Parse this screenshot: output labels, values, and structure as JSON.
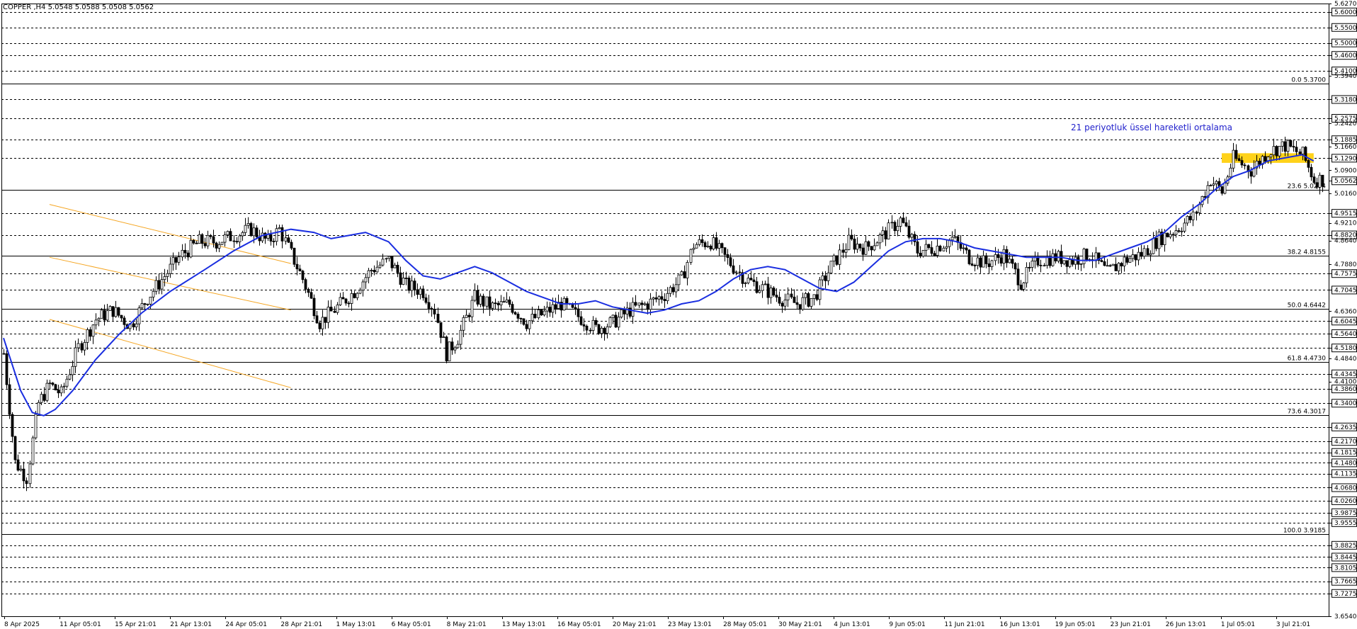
{
  "header": {
    "symbol_ohlc": "COPPER ,H4  5.0548 5.0588 5.0508 5.0562"
  },
  "colors": {
    "background": "#ffffff",
    "candle": "#000000",
    "ema": "#1a2ee0",
    "channel": "#f5a623",
    "zone": "#ffd21a",
    "annotation": "#2222cc"
  },
  "annotation": {
    "ema_label": "21 periyotluk üssel hareketli ortalama"
  },
  "chart_data": {
    "type": "candlestick",
    "symbol": "COPPER",
    "timeframe": "H4",
    "ylim": [
      3.654,
      5.627
    ],
    "current_price": 5.0562,
    "x_tick_labels": [
      "8 Apr 2025",
      "11 Apr 05:01",
      "15 Apr 21:01",
      "21 Apr 13:01",
      "24 Apr 05:01",
      "28 Apr 21:01",
      "1 May 13:01",
      "6 May 05:01",
      "8 May 21:01",
      "13 May 13:01",
      "16 May 05:01",
      "20 May 21:01",
      "23 May 13:01",
      "28 May 05:01",
      "30 May 21:01",
      "4 Jun 13:01",
      "9 Jun 05:01",
      "11 Jun 21:01",
      "16 Jun 13:01",
      "19 Jun 05:01",
      "23 Jun 21:01",
      "26 Jun 13:01",
      "1 Jul 05:01",
      "3 Jul 21:01"
    ],
    "price_axis_labels": [
      "5.6270",
      "5.6000",
      "5.5500",
      "5.5000",
      "5.4600",
      "5.4100",
      "5.3940",
      "5.3180",
      "5.2575",
      "5.2420",
      "5.1885",
      "5.1660",
      "5.1290",
      "5.0900",
      "5.0562",
      "5.0160",
      "4.9515",
      "4.9210",
      "4.8820",
      "4.8640",
      "4.7880",
      "4.7575",
      "4.7045",
      "4.6360",
      "4.6045",
      "4.5640",
      "4.5180",
      "4.4840",
      "4.4345",
      "4.4100",
      "4.3860",
      "4.3400",
      "4.2635",
      "4.2170",
      "4.1815",
      "4.1480",
      "4.1135",
      "4.0680",
      "4.0260",
      "3.9875",
      "3.9555",
      "3.8825",
      "3.8445",
      "3.8105",
      "3.7665",
      "3.7275",
      "3.6540"
    ],
    "highlighted_price_labels": [
      "5.6000",
      "5.5500",
      "5.5000",
      "5.4600",
      "5.4100",
      "5.3180",
      "5.2575",
      "5.1885",
      "5.1290",
      "5.0562",
      "4.9515",
      "4.8820",
      "4.7575",
      "4.7045",
      "4.6045",
      "4.5640",
      "4.5180",
      "4.4345",
      "4.3860",
      "4.3400",
      "4.2635",
      "4.2170",
      "4.1815",
      "4.1480",
      "4.1135",
      "4.0680",
      "4.0260",
      "3.9875",
      "3.9555",
      "3.8825",
      "3.8445",
      "3.8105",
      "3.7665",
      "3.7275"
    ],
    "dashed_levels": [
      5.6,
      5.55,
      5.5,
      5.46,
      5.41,
      5.318,
      5.2575,
      5.1885,
      5.129,
      4.9515,
      4.882,
      4.7575,
      4.7045,
      4.6045,
      4.564,
      4.518,
      4.4345,
      4.386,
      4.34,
      4.2635,
      4.217,
      4.1815,
      4.148,
      4.1135,
      4.068,
      4.026,
      3.9875,
      3.9555,
      3.8825,
      3.8445,
      3.8105,
      3.7665,
      3.7275
    ],
    "fibonacci": [
      {
        "label": "0.0 5.3700",
        "price": 5.37
      },
      {
        "label": "23.6 5.0274",
        "price": 5.0274
      },
      {
        "label": "38.2 4.8155",
        "price": 4.8155
      },
      {
        "label": "50.0 4.6442",
        "price": 4.6442
      },
      {
        "label": "61.8 4.4730",
        "price": 4.473
      },
      {
        "label": "73.6 4.3017",
        "price": 4.3017
      },
      {
        "label": "100.0 3.9185",
        "price": 3.9185
      }
    ],
    "ema_period": 21,
    "ema_points": [
      [
        0,
        4.55
      ],
      [
        6,
        4.38
      ],
      [
        10,
        4.31
      ],
      [
        14,
        4.3
      ],
      [
        18,
        4.32
      ],
      [
        24,
        4.38
      ],
      [
        32,
        4.48
      ],
      [
        40,
        4.56
      ],
      [
        48,
        4.63
      ],
      [
        58,
        4.7
      ],
      [
        70,
        4.77
      ],
      [
        80,
        4.83
      ],
      [
        90,
        4.88
      ],
      [
        100,
        4.9
      ],
      [
        108,
        4.89
      ],
      [
        114,
        4.87
      ],
      [
        120,
        4.88
      ],
      [
        126,
        4.89
      ],
      [
        134,
        4.86
      ],
      [
        140,
        4.8
      ],
      [
        146,
        4.75
      ],
      [
        152,
        4.74
      ],
      [
        158,
        4.76
      ],
      [
        164,
        4.78
      ],
      [
        170,
        4.76
      ],
      [
        176,
        4.73
      ],
      [
        182,
        4.7
      ],
      [
        188,
        4.68
      ],
      [
        194,
        4.66
      ],
      [
        200,
        4.66
      ],
      [
        206,
        4.67
      ],
      [
        212,
        4.65
      ],
      [
        218,
        4.64
      ],
      [
        224,
        4.63
      ],
      [
        230,
        4.64
      ],
      [
        236,
        4.66
      ],
      [
        242,
        4.67
      ],
      [
        248,
        4.7
      ],
      [
        254,
        4.74
      ],
      [
        260,
        4.77
      ],
      [
        266,
        4.78
      ],
      [
        272,
        4.77
      ],
      [
        278,
        4.74
      ],
      [
        284,
        4.71
      ],
      [
        290,
        4.7
      ],
      [
        296,
        4.73
      ],
      [
        302,
        4.78
      ],
      [
        308,
        4.83
      ],
      [
        314,
        4.86
      ],
      [
        320,
        4.87
      ],
      [
        326,
        4.87
      ],
      [
        332,
        4.86
      ],
      [
        338,
        4.84
      ],
      [
        344,
        4.83
      ],
      [
        350,
        4.82
      ],
      [
        356,
        4.81
      ],
      [
        362,
        4.81
      ],
      [
        368,
        4.81
      ],
      [
        374,
        4.8
      ],
      [
        380,
        4.8
      ],
      [
        386,
        4.82
      ],
      [
        392,
        4.84
      ],
      [
        398,
        4.86
      ],
      [
        404,
        4.89
      ],
      [
        410,
        4.94
      ],
      [
        416,
        4.98
      ],
      [
        422,
        5.03
      ],
      [
        428,
        5.07
      ],
      [
        434,
        5.09
      ],
      [
        440,
        5.12
      ],
      [
        446,
        5.13
      ],
      [
        452,
        5.14
      ],
      [
        456,
        5.12
      ]
    ],
    "channel_lines": [
      {
        "from": [
          16,
          4.98
        ],
        "to": [
          100,
          4.79
        ]
      },
      {
        "from": [
          16,
          4.81
        ],
        "to": [
          100,
          4.64
        ]
      },
      {
        "from": [
          16,
          4.61
        ],
        "to": [
          100,
          4.39
        ]
      }
    ],
    "resistance_zone": {
      "x_from": 424,
      "x_to": 456,
      "y_low": 5.114,
      "y_high": 5.145
    },
    "candle_count": 460,
    "price_path": [
      [
        0,
        4.5
      ],
      [
        4,
        4.15
      ],
      [
        8,
        4.1
      ],
      [
        12,
        4.34
      ],
      [
        16,
        4.4
      ],
      [
        20,
        4.37
      ],
      [
        26,
        4.52
      ],
      [
        32,
        4.61
      ],
      [
        38,
        4.64
      ],
      [
        44,
        4.59
      ],
      [
        50,
        4.68
      ],
      [
        56,
        4.75
      ],
      [
        62,
        4.82
      ],
      [
        68,
        4.86
      ],
      [
        74,
        4.86
      ],
      [
        80,
        4.88
      ],
      [
        86,
        4.9
      ],
      [
        92,
        4.86
      ],
      [
        96,
        4.9
      ],
      [
        100,
        4.82
      ],
      [
        104,
        4.74
      ],
      [
        110,
        4.6
      ],
      [
        116,
        4.65
      ],
      [
        122,
        4.7
      ],
      [
        128,
        4.77
      ],
      [
        134,
        4.8
      ],
      [
        140,
        4.72
      ],
      [
        146,
        4.7
      ],
      [
        150,
        4.64
      ],
      [
        154,
        4.5
      ],
      [
        158,
        4.55
      ],
      [
        164,
        4.68
      ],
      [
        170,
        4.65
      ],
      [
        176,
        4.66
      ],
      [
        182,
        4.6
      ],
      [
        188,
        4.63
      ],
      [
        194,
        4.66
      ],
      [
        200,
        4.62
      ],
      [
        206,
        4.58
      ],
      [
        212,
        4.6
      ],
      [
        218,
        4.64
      ],
      [
        224,
        4.66
      ],
      [
        230,
        4.69
      ],
      [
        236,
        4.74
      ],
      [
        240,
        4.85
      ],
      [
        246,
        4.86
      ],
      [
        252,
        4.8
      ],
      [
        258,
        4.74
      ],
      [
        264,
        4.71
      ],
      [
        270,
        4.68
      ],
      [
        276,
        4.66
      ],
      [
        282,
        4.68
      ],
      [
        288,
        4.78
      ],
      [
        294,
        4.86
      ],
      [
        300,
        4.84
      ],
      [
        306,
        4.88
      ],
      [
        312,
        4.93
      ],
      [
        318,
        4.83
      ],
      [
        324,
        4.84
      ],
      [
        330,
        4.87
      ],
      [
        336,
        4.81
      ],
      [
        342,
        4.79
      ],
      [
        348,
        4.82
      ],
      [
        354,
        4.73
      ],
      [
        360,
        4.8
      ],
      [
        366,
        4.81
      ],
      [
        372,
        4.8
      ],
      [
        378,
        4.82
      ],
      [
        384,
        4.76
      ],
      [
        390,
        4.8
      ],
      [
        396,
        4.82
      ],
      [
        402,
        4.87
      ],
      [
        408,
        4.9
      ],
      [
        414,
        4.94
      ],
      [
        420,
        5.06
      ],
      [
        424,
        5.02
      ],
      [
        428,
        5.13
      ],
      [
        434,
        5.09
      ],
      [
        440,
        5.15
      ],
      [
        446,
        5.17
      ],
      [
        452,
        5.14
      ],
      [
        456,
        5.06
      ]
    ]
  }
}
